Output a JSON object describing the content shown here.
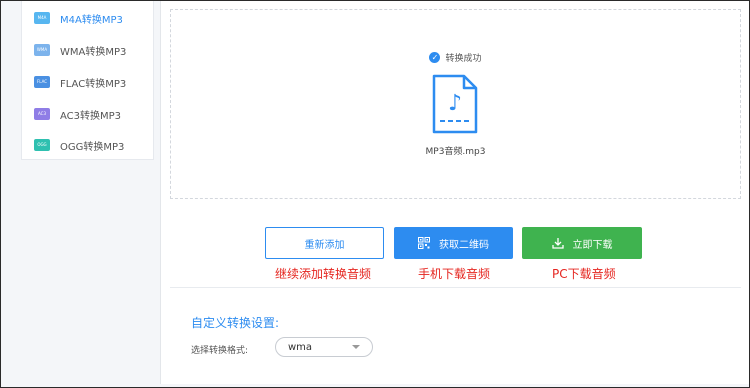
{
  "sidebar": {
    "items": [
      {
        "label": "M4A转换MP3",
        "icon": "m4a-file-icon",
        "badge": "M4A",
        "color": "#57b6f0",
        "active": true
      },
      {
        "label": "WMA转换MP3",
        "icon": "wma-file-icon",
        "badge": "WMA",
        "color": "#7cb3ec",
        "active": false
      },
      {
        "label": "FLAC转换MP3",
        "icon": "flac-file-icon",
        "badge": "FLAC",
        "color": "#4a90e2",
        "active": false
      },
      {
        "label": "AC3转换MP3",
        "icon": "ac3-file-icon",
        "badge": "AC3",
        "color": "#8f7de6",
        "active": false
      },
      {
        "label": "OGG转换MP3",
        "icon": "ogg-file-icon",
        "badge": "OGG",
        "color": "#2fc0b0",
        "active": false
      }
    ]
  },
  "result": {
    "status": "转换成功",
    "filename": "MP3音频.mp3"
  },
  "actions": {
    "readd": "重新添加",
    "qrcode": "获取二维码",
    "download": "立即下载"
  },
  "annotations": {
    "readd": "继续添加转换音频",
    "qrcode": "手机下载音频",
    "download": "PC下载音频"
  },
  "settings": {
    "title": "自定义转换设置:",
    "format_label": "选择转换格式:",
    "format_value": "wma"
  },
  "colors": {
    "accent": "#2d8cf0",
    "download": "#3fb34f",
    "annotation": "#e5251f"
  }
}
